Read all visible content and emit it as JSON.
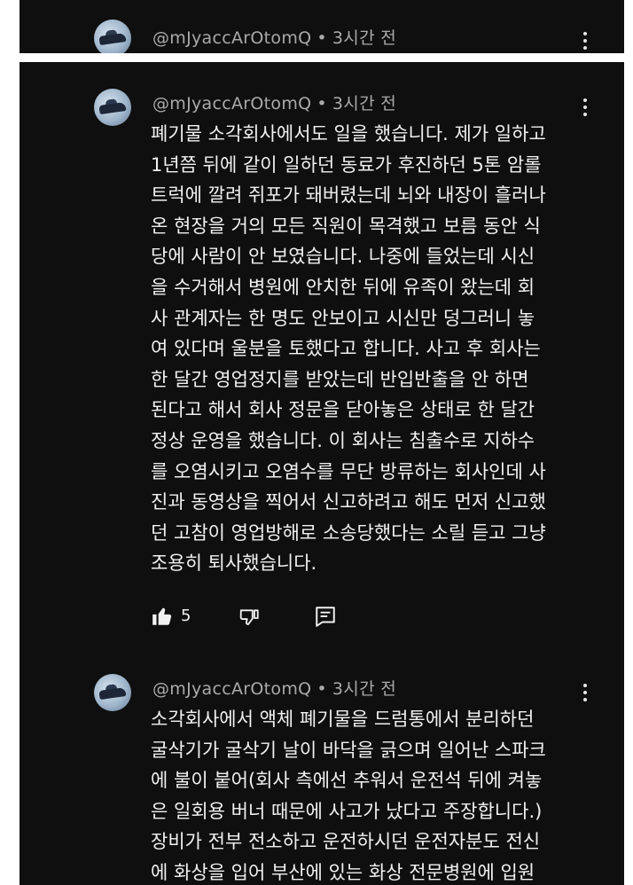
{
  "comments": [
    {
      "author": "@mJyaccArOtomQ",
      "time": "3시간 전",
      "lines": []
    },
    {
      "author": "@mJyaccArOtomQ",
      "time": "3시간 전",
      "lines": [
        "폐기물 소각회사에서도 일을 했습니다. 제가 일하고",
        "1년쯤 뒤에 같이 일하던 동료가 후진하던 5톤 암롤",
        "트럭에 깔려 쥐포가 돼버렸는데 뇌와 내장이 흘러나",
        "온 현장을 거의 모든 직원이 목격했고 보름 동안 식",
        "당에 사람이 안 보였습니다. 나중에 들었는데 시신",
        "을 수거해서 병원에 안치한 뒤에 유족이 왔는데 회",
        "사 관계자는 한 명도 안보이고 시신만 덩그러니 놓",
        "여 있다며 울분을 토했다고 합니다. 사고 후 회사는",
        "한 달간 영업정지를 받았는데 반입반출을 안 하면",
        "된다고 해서 회사 정문을 닫아놓은 상태로 한 달간",
        "정상 운영을 했습니다. 이 회사는 침출수로 지하수",
        "를 오염시키고 오염수를 무단 방류하는 회사인데 사",
        "진과 동영상을 찍어서 신고하려고 해도 먼저 신고했",
        "던 고참이 영업방해로 소송당했다는 소릴 듣고 그냥",
        "조용히 퇴사했습니다."
      ],
      "likes": "5"
    },
    {
      "author": "@mJyaccArOtomQ",
      "time": "3시간 전",
      "lines": [
        "소각회사에서 액체 폐기물을 드럼통에서 분리하던",
        "굴삭기가 굴삭기 날이 바닥을 긁으며 일어난 스파크",
        "에 불이 붙어(회사 측에선 추워서 운전석 뒤에 켜놓",
        "은 일회용 버너 때문에 사고가 났다고 주장합니다.)",
        "장비가 전부 전소하고 운전하시던 운전자분도 전신",
        "에 화상을 입어 부산에 있는 화상 전문병원에 입원"
      ]
    }
  ],
  "icons": {
    "like": "thumb-up-icon",
    "dislike": "thumb-down-icon",
    "reply": "reply-icon",
    "more": "more-vertical-icon"
  },
  "colors": {
    "background": "#0f0f0f",
    "page": "#ffffff",
    "text": "#f1f1f1",
    "meta": "#aaaaaa"
  }
}
